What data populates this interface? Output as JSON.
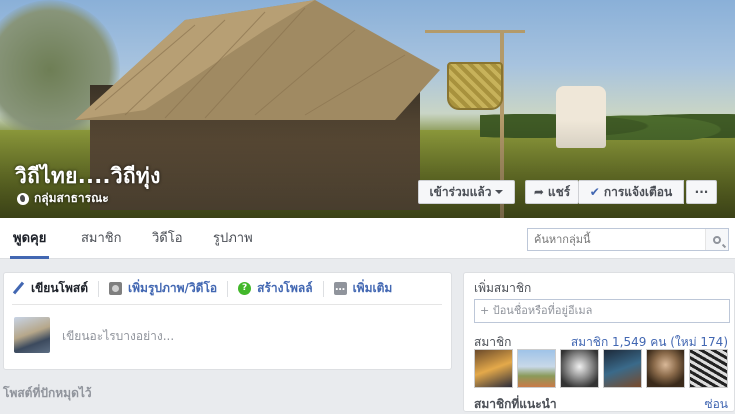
{
  "group": {
    "title": "วิถีไทย....วิถีทุ่ง",
    "privacy": "กลุ่มสาธารณะ"
  },
  "cover_actions": {
    "joined": "เข้าร่วมแล้ว",
    "share": "แชร์",
    "notifications": "การแจ้งเตือน",
    "more": "···"
  },
  "tabs": [
    "พูดคุย",
    "สมาชิก",
    "วิดีโอ",
    "รูปภาพ"
  ],
  "search": {
    "placeholder": "ค้นหากลุ่มนี้"
  },
  "composer": {
    "tabs": [
      "เขียนโพสต์",
      "เพิ่มรูปภาพ/วิดีโอ",
      "สร้างโพลล์",
      "เพิ่มเติม"
    ],
    "placeholder": "เขียนอะไรบางอย่าง..."
  },
  "pinned": {
    "label": "โพสต์ที่ปักหมุดไว้"
  },
  "sidebar": {
    "add_members_title": "เพิ่มสมาชิก",
    "add_members_placeholder": "+ ป้อนชื่อหรือที่อยู่อีเมล",
    "members_label": "สมาชิก",
    "members_count": "สมาชิก 1,549 คน (ใหม่ 174)",
    "cut_label": "สมาชิกที่แนะนำ",
    "cut_link": "ซ่อน"
  },
  "colors": {
    "accent": "#4267b2",
    "page_bg": "#e9ebee"
  }
}
